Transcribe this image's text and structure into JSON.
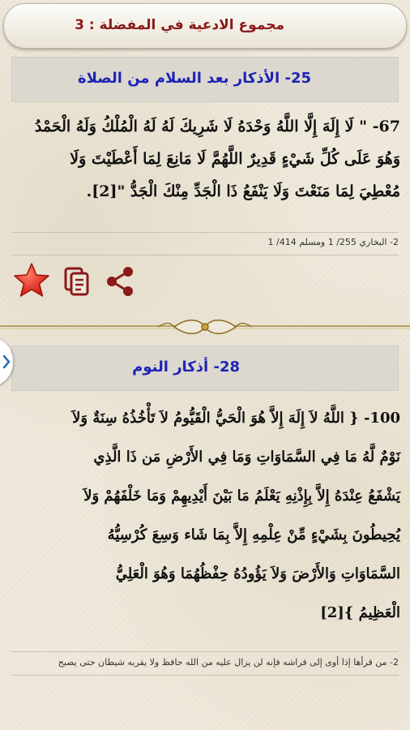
{
  "header": {
    "title": "مجموع الادعية في المفضلة : 3"
  },
  "section1": {
    "heading": "25- الأذكار بعد السلام من الصلاة",
    "line1": "67- \" لَا إِلَهَ إِلَّا اللَّهُ وَحْدَهُ لَا شَرِيكَ لَهُ لَهُ الْمُلْكُ وَلَهُ الْحَمْدُ",
    "line2": "وَهُوَ عَلَى كُلِّ شَيْءٍ قَدِيرٌ اللَّهُمَّ لَا مَانِعَ لِمَا أَعْطَيْتَ وَلَا",
    "line3": "مُعْطِيَ لِمَا مَنَعْتَ وَلَا يَنْفَعُ ذَا الْجَدِّ مِنْكَ الْجَدُّ \"[2].",
    "footnote": "2- البخاري 255/ 1 ومسلم 414/ 1"
  },
  "actions": {
    "favorite_icon": "star-icon",
    "copy_icon": "copy-icon",
    "share_icon": "share-icon"
  },
  "section2": {
    "heading": "28- أذكار النوم",
    "line1": "100- { اللَّهُ لاَ إِلَهَ إِلاَّ هُوَ الْحَيُّ الْقَيُّومُ لاَ تَأْخُذُهُ سِنَةٌ وَلاَ",
    "line2": "نَوْمٌ لَّهُ مَا فِي السَّمَاوَاتِ وَمَا فِي الأَرْضِ مَن ذَا الَّذِي",
    "line3": "يَشْفَعُ عِنْدَهُ إِلاَّ بِإِذْنِهِ يَعْلَمُ مَا بَيْنَ أَيْدِيهِمْ وَمَا خَلْفَهُمْ وَلاَ",
    "line4": "يُحِيطُونَ بِشَيْءٍ مِّنْ عِلْمِهِ إِلاَّ بِمَا شَاء وَسِعَ كُرْسِيُّهُ",
    "line5": "السَّمَاوَاتِ وَالأَرْضَ وَلاَ يَؤُودُهُ حِفْظُهُمَا وَهُوَ الْعَلِيُّ",
    "line6": "الْعَظِيمُ }[2]",
    "footnote": "2- من قرأها إذا أوى إلى فراشه فإنه لن يزال عليه من الله حافظ ولا يقربه شيطان حتى يصبح"
  },
  "colors": {
    "title": "#8a1a1a",
    "heading": "#1e23b5",
    "icon": "#8a1a1a",
    "star": "#e8281c"
  }
}
